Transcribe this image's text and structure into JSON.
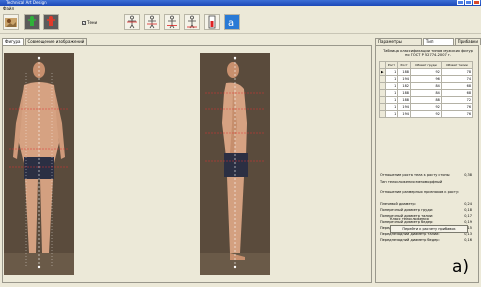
{
  "window": {
    "title": "Technical Art Design"
  },
  "menu": {
    "label": "Файл"
  },
  "toolbar": {
    "checkbox_label": "Тени",
    "checkbox_checked": true,
    "buttons": [
      {
        "name": "open-photo-icon"
      },
      {
        "name": "figure-green-icon"
      },
      {
        "name": "figure-red-icon"
      },
      {
        "name": "pose-front-icon"
      },
      {
        "name": "pose-side-icon"
      },
      {
        "name": "pose-arms-icon"
      },
      {
        "name": "pose-back-icon"
      },
      {
        "name": "measure-tool-icon"
      },
      {
        "name": "text-tool-icon"
      }
    ]
  },
  "left_tabs": [
    "Фигура",
    "Совмещение изображений"
  ],
  "right_tabs": [
    "Параметры фигуры",
    "Тип фигуры",
    "Прибавки"
  ],
  "right_panel": {
    "title_line1": "Таблица классификации типов мужских фигур",
    "title_line2": "по ГОСТ Р 52774-2007 г.",
    "table": {
      "headers": [
        "",
        "Рост",
        "Рост",
        "Обхват груди",
        "Обхват талии"
      ],
      "rows": [
        [
          "▶",
          "1",
          "188",
          "92",
          "78"
        ],
        [
          "",
          "1",
          "194",
          "96",
          "74"
        ],
        [
          "",
          "1",
          "182",
          "84",
          "68"
        ],
        [
          "",
          "1",
          "188",
          "84",
          "68"
        ],
        [
          "",
          "1",
          "188",
          "88",
          "72"
        ],
        [
          "",
          "1",
          "194",
          "92",
          "76"
        ],
        [
          "",
          "1",
          "194",
          "92",
          "76"
        ]
      ]
    },
    "ratio_label": "Отношение роста тела к росту стопы",
    "ratio_value": "0,38",
    "body_type_label": "Тип телосложения:",
    "body_type_value": "мезоморфный",
    "signs_header": "Отношение размерных признаков к росту:",
    "measures": [
      {
        "label": "Плечевой диаметр:",
        "value": "0,24"
      },
      {
        "label": "Поперечный диаметр груди:",
        "value": "0,18"
      },
      {
        "label": "Поперечный диаметр талии:",
        "value": "0,17"
      },
      {
        "label": "Поперечный диаметр бедер:",
        "value": "0,19"
      },
      {
        "label": "Переднезадний диаметр груди:",
        "value": "0,15"
      },
      {
        "label": "Переднезадний диаметр талии:",
        "value": "0,13"
      },
      {
        "label": "Переднезадний диаметр бедер:",
        "value": "0,16"
      }
    ],
    "class_label": "Класс телосложения",
    "button_label": "Перейти к расчету прибавок"
  },
  "corner_label": "a)"
}
